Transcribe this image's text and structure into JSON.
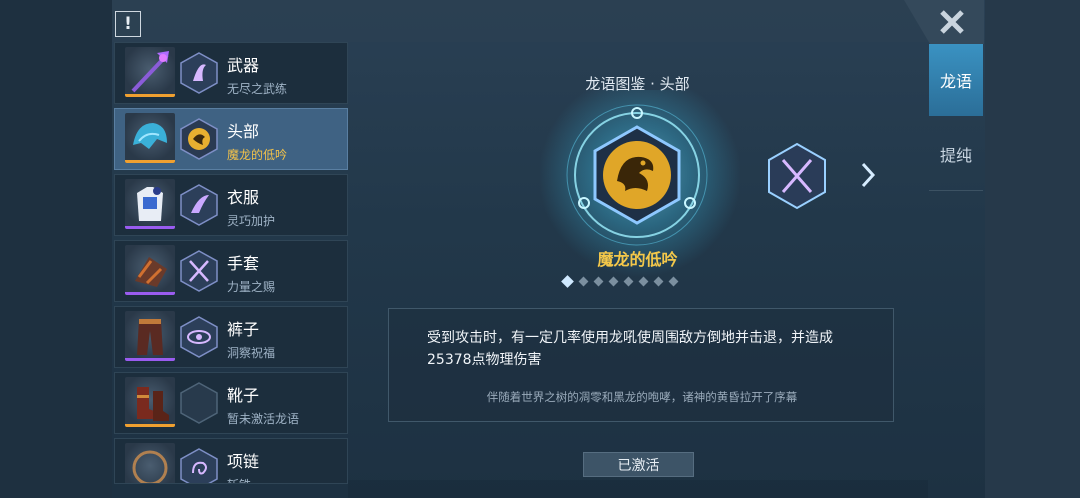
{
  "alert_icon": "!",
  "close_icon": "close-x-icon",
  "tabs": [
    {
      "label": "龙语",
      "active": true
    },
    {
      "label": "提纯",
      "active": false
    }
  ],
  "equipment": [
    {
      "name": "武器",
      "sub": "无尽之武练",
      "bar": "#f0a030",
      "item_icon": "staff-icon",
      "glyph_icon": "phoenix-rune-icon"
    },
    {
      "name": "头部",
      "sub": "魔龙的低吟",
      "bar": "#f0a030",
      "item_icon": "helmet-icon",
      "glyph_icon": "golden-dragon-rune-icon",
      "active": true
    },
    {
      "name": "衣服",
      "sub": "灵巧加护",
      "bar": "#9a5cf0",
      "item_icon": "armor-icon",
      "glyph_icon": "feather-rune-icon"
    },
    {
      "name": "手套",
      "sub": "力量之赐",
      "bar": "#9a5cf0",
      "item_icon": "gauntlet-icon",
      "glyph_icon": "crossed-swords-rune-icon"
    },
    {
      "name": "裤子",
      "sub": "洞察祝福",
      "bar": "#9a5cf0",
      "item_icon": "pants-icon",
      "glyph_icon": "eye-rune-icon"
    },
    {
      "name": "靴子",
      "sub": "暂未激活龙语",
      "bar": "#f0a030",
      "item_icon": "boots-icon",
      "glyph_icon": "empty-rune-slot-icon"
    },
    {
      "name": "项链",
      "sub": "斩铁",
      "bar": "#f0a030",
      "item_icon": "necklace-icon",
      "glyph_icon": "swirl-rune-icon"
    }
  ],
  "codex": {
    "title": "龙语图鉴 · 头部",
    "name": "魔龙的低吟",
    "dot_count": 8,
    "active_dot": 0,
    "description": "受到攻击时，有一定几率使用龙吼使周围敌方倒地并击退，并造成25378点物理伤害",
    "flavor": "伴随着世界之树的凋零和黑龙的咆哮，诸神的黄昏拉开了序幕",
    "activated_label": "已激活",
    "next_icon": "crossed-swords-rune-icon",
    "arrow_icon": "chevron-right-icon"
  },
  "colors": {
    "accent": "#3a92c2",
    "gold": "#f4c84a",
    "epic": "#9a5cf0",
    "legend": "#f0a030"
  }
}
